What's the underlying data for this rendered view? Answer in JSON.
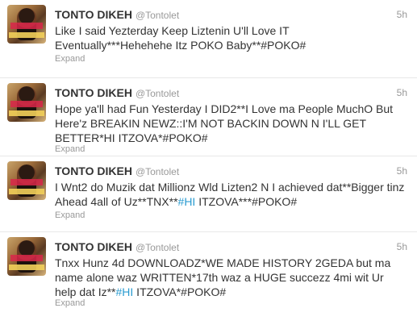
{
  "tweets": [
    {
      "name": "TONTO DIKEH",
      "handle": "@Tontolet",
      "time": "5h",
      "text_before": "Like I said Yezterday Keep Liztenin U'll Love IT Eventually***Hehehehe Itz POKO Baby**#POKO#",
      "hashtag": "",
      "text_after": "",
      "expand": "Expand"
    },
    {
      "name": "TONTO DIKEH",
      "handle": "@Tontolet",
      "time": "5h",
      "text_before": "Hope ya'll had Fun Yesterday I DID2**I Love ma People MuchO But Here'z BREAKIN NEWZ::I'M NOT BACKIN DOWN N I'LL GET BETTER*HI ITZOVA*#POKO#",
      "hashtag": "",
      "text_after": "",
      "expand": "Expand"
    },
    {
      "name": "TONTO DIKEH",
      "handle": "@Tontolet",
      "time": "5h",
      "text_before": "I Wnt2 do Muzik dat Millionz Wld Lizten2 N I achieved dat**Bigger tinz Ahead 4all of Uz**TNX**",
      "hashtag": "#HI",
      "text_after": " ITZOVA***#POKO#",
      "expand": "Expand"
    },
    {
      "name": "TONTO DIKEH",
      "handle": "@Tontolet",
      "time": "5h",
      "text_before": "Tnxx Hunz 4d DOWNLOADZ*WE MADE HISTORY 2GEDA but ma name alone waz WRITTEN*17th waz a HUGE succezz 4mi wit Ur help dat Iz**",
      "hashtag": "#HI",
      "text_after": " ITZOVA*#POKO#",
      "expand": "Expand"
    }
  ],
  "colors": {
    "hashtag": "#2a9bd0",
    "meta": "#999999",
    "text": "#333333"
  }
}
